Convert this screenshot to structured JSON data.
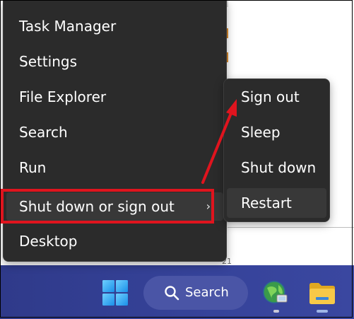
{
  "menu": {
    "items": [
      {
        "label": "Task Manager"
      },
      {
        "label": "Settings"
      },
      {
        "label": "File Explorer"
      },
      {
        "label": "Search"
      },
      {
        "label": "Run"
      },
      {
        "label": "Shut down or sign out",
        "has_submenu": true,
        "chevron": "›"
      },
      {
        "label": "Desktop"
      }
    ]
  },
  "submenu": {
    "items": [
      {
        "label": "Sign out"
      },
      {
        "label": "Sleep"
      },
      {
        "label": "Shut down"
      },
      {
        "label": "Restart"
      }
    ]
  },
  "background": {
    "digit": "21"
  },
  "taskbar": {
    "search_label": "Search",
    "start_icon": "windows-start-icon",
    "apps": [
      {
        "icon": "globe-network-icon"
      },
      {
        "icon": "file-explorer-folder-icon"
      }
    ]
  },
  "annotation": {
    "color": "#e0141e"
  },
  "colors": {
    "menu_bg": "#2b2b2b",
    "menu_hover": "#383838",
    "taskbar_bg": "#323c8c",
    "accent_red": "#e0141e"
  }
}
